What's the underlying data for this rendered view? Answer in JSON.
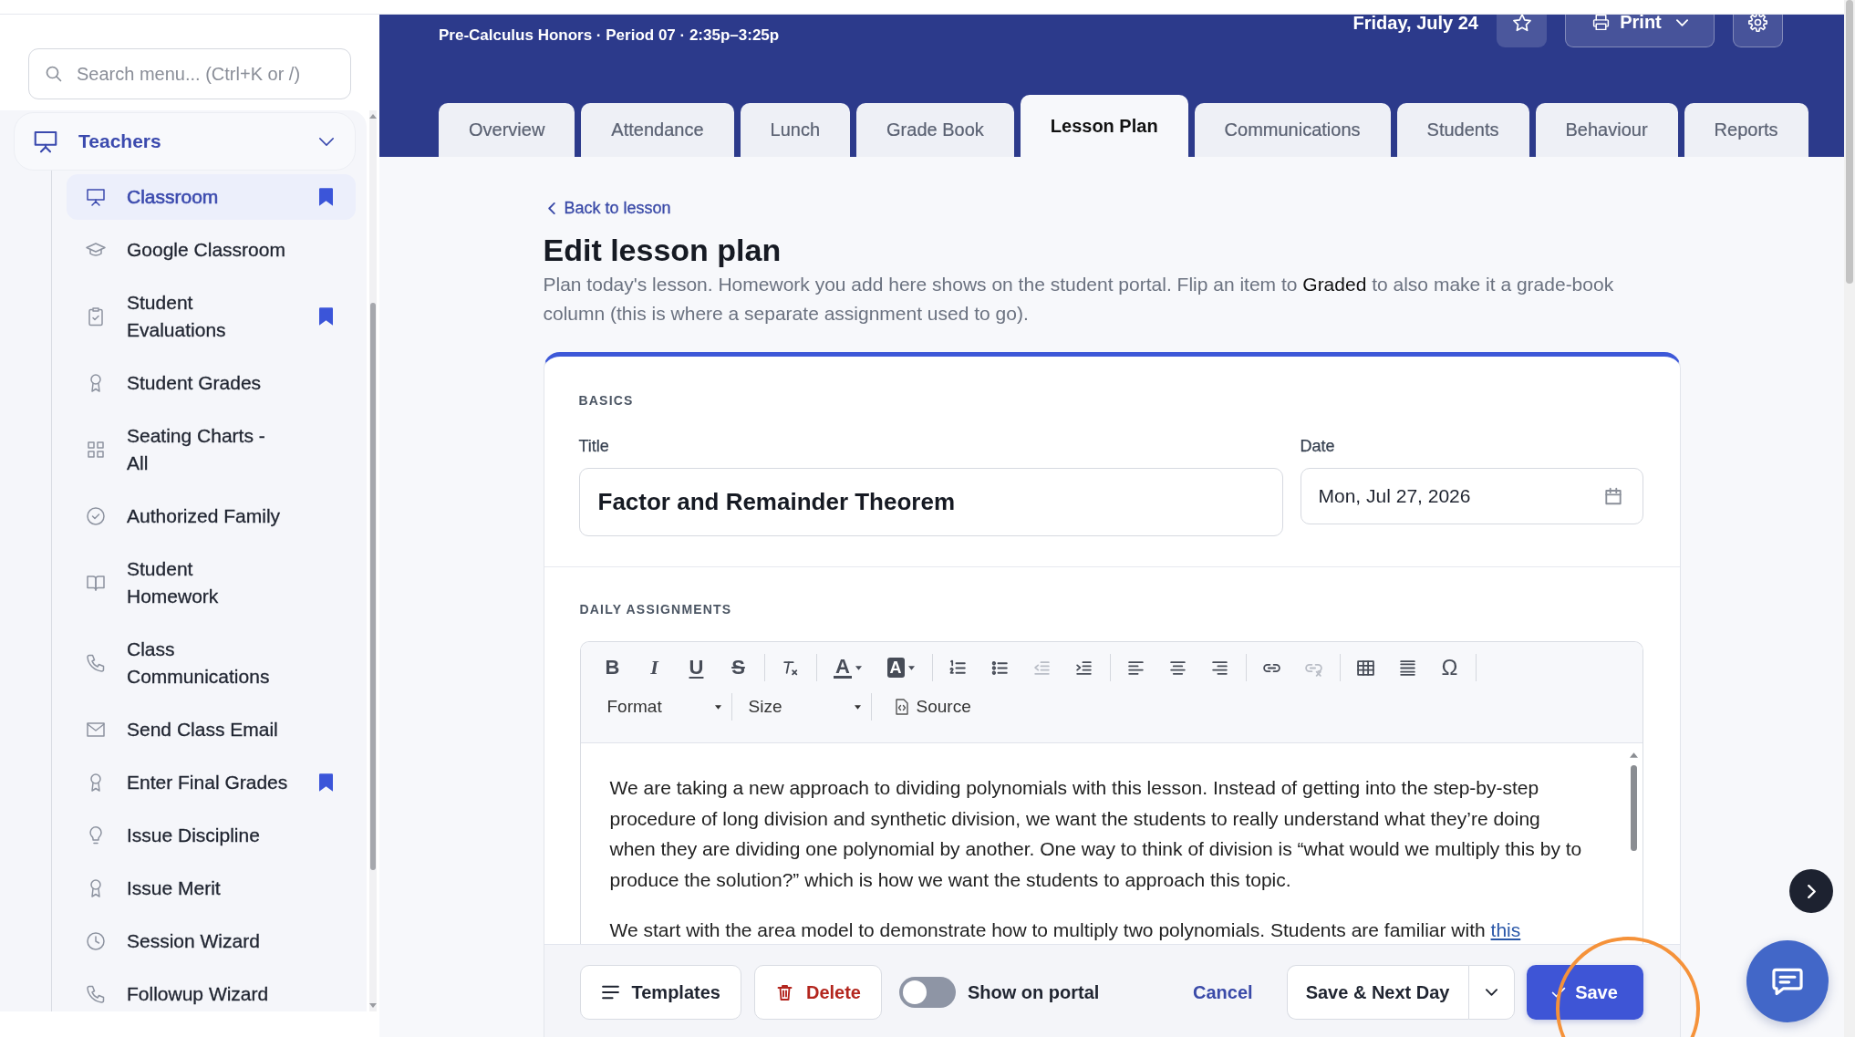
{
  "sidebar": {
    "search": {
      "placeholder": "Search menu... (Ctrl+K or /)"
    },
    "section": {
      "label": "Teachers",
      "expanded": true,
      "items": [
        {
          "label": "Classroom",
          "selected": true,
          "bookmarked": true
        },
        {
          "label": "Google Classroom",
          "selected": false,
          "bookmarked": false
        },
        {
          "label": "Student Evaluations",
          "selected": false,
          "bookmarked": true
        },
        {
          "label": "Student Grades",
          "selected": false,
          "bookmarked": false
        },
        {
          "label": "Seating Charts - All",
          "selected": false,
          "bookmarked": false
        },
        {
          "label": "Authorized Family",
          "selected": false,
          "bookmarked": false
        },
        {
          "label": "Student Homework",
          "selected": false,
          "bookmarked": false
        },
        {
          "label": "Class Communications",
          "selected": false,
          "bookmarked": false
        },
        {
          "label": "Send Class Email",
          "selected": false,
          "bookmarked": false
        },
        {
          "label": "Enter Final Grades",
          "selected": false,
          "bookmarked": true
        },
        {
          "label": "Issue Discipline",
          "selected": false,
          "bookmarked": false
        },
        {
          "label": "Issue Merit",
          "selected": false,
          "bookmarked": false
        },
        {
          "label": "Session Wizard",
          "selected": false,
          "bookmarked": false
        },
        {
          "label": "Followup Wizard",
          "selected": false,
          "bookmarked": false
        }
      ]
    }
  },
  "header": {
    "subtitle": "Pre-Calculus Honors · Period 07 · 2:35p–3:25p",
    "date": "Friday, July 24",
    "print_label": "Print"
  },
  "tabs": [
    {
      "label": "Overview",
      "selected": false
    },
    {
      "label": "Attendance",
      "selected": false
    },
    {
      "label": "Lunch",
      "selected": false
    },
    {
      "label": "Grade Book",
      "selected": false
    },
    {
      "label": "Lesson Plan",
      "selected": true
    },
    {
      "label": "Communications",
      "selected": false
    },
    {
      "label": "Students",
      "selected": false
    },
    {
      "label": "Behaviour",
      "selected": false
    },
    {
      "label": "Reports",
      "selected": false
    }
  ],
  "page": {
    "back_link": "Back to lesson",
    "title": "Edit lesson plan",
    "description": "Plan today's lesson. Homework you add here shows on the student portal. Flip an item to **Graded** to also make it a grade-book column (this is where a separate assignment used to go)."
  },
  "basics": {
    "heading": "BASICS",
    "title_field": {
      "label": "Title",
      "value": "Factor and Remainder Theorem"
    },
    "date_field": {
      "label": "Date",
      "value": "Mon, Jul 27, 2026"
    }
  },
  "assignments": {
    "heading": "DAILY ASSIGNMENTS",
    "toolbar": [
      [
        {
          "kind": "glyph",
          "text": "B",
          "disabled": false
        },
        {
          "kind": "glyph",
          "text": "I",
          "disabled": false
        },
        {
          "kind": "glyph",
          "text": "U",
          "disabled": false
        },
        {
          "kind": "glyph",
          "text": "S",
          "disabled": false
        }
      ],
      [
        {
          "kind": "icon",
          "disabled": false
        }
      ],
      [
        {
          "kind": "menu",
          "text": "A",
          "disabled": false
        },
        {
          "kind": "menu",
          "text": "A",
          "disabled": false
        }
      ],
      [
        {
          "kind": "icon",
          "disabled": false
        },
        {
          "kind": "icon",
          "disabled": false
        },
        {
          "kind": "icon",
          "disabled": true
        },
        {
          "kind": "icon",
          "disabled": false
        }
      ],
      [
        {
          "kind": "icon",
          "disabled": false
        },
        {
          "kind": "icon",
          "disabled": false
        },
        {
          "kind": "icon",
          "disabled": false
        }
      ],
      [
        {
          "kind": "icon",
          "disabled": false
        },
        {
          "kind": "icon",
          "disabled": true
        }
      ],
      [
        {
          "kind": "icon",
          "disabled": false
        },
        {
          "kind": "icon",
          "disabled": false
        },
        {
          "kind": "glyph",
          "text": "Ω",
          "disabled": false
        }
      ]
    ],
    "format_menu": "Format",
    "size_menu": "Size",
    "source_button": "Source",
    "paragraphs": [
      {
        "text": "We are taking a new approach to dividing polynomials with this lesson. Instead of getting into the step-by-step procedure of long division and synthetic division, we want the students to really understand what they’re doing when they are dividing one polynomial by another. One way to think of division is “what would we multiply this by to produce the solution?” which is how we want the students to approach this topic."
      },
      {
        "text": "We start with the area model to demonstrate how to multiply two polynomials. Students are familiar with",
        "link": "this"
      }
    ]
  },
  "footer": {
    "templates_button": "Templates",
    "delete_button": "Delete",
    "portal_toggle": {
      "label": "Show on portal",
      "on": false
    },
    "cancel_link": "Cancel",
    "save_next_button": "Save & Next Day",
    "save_button": "Save"
  }
}
